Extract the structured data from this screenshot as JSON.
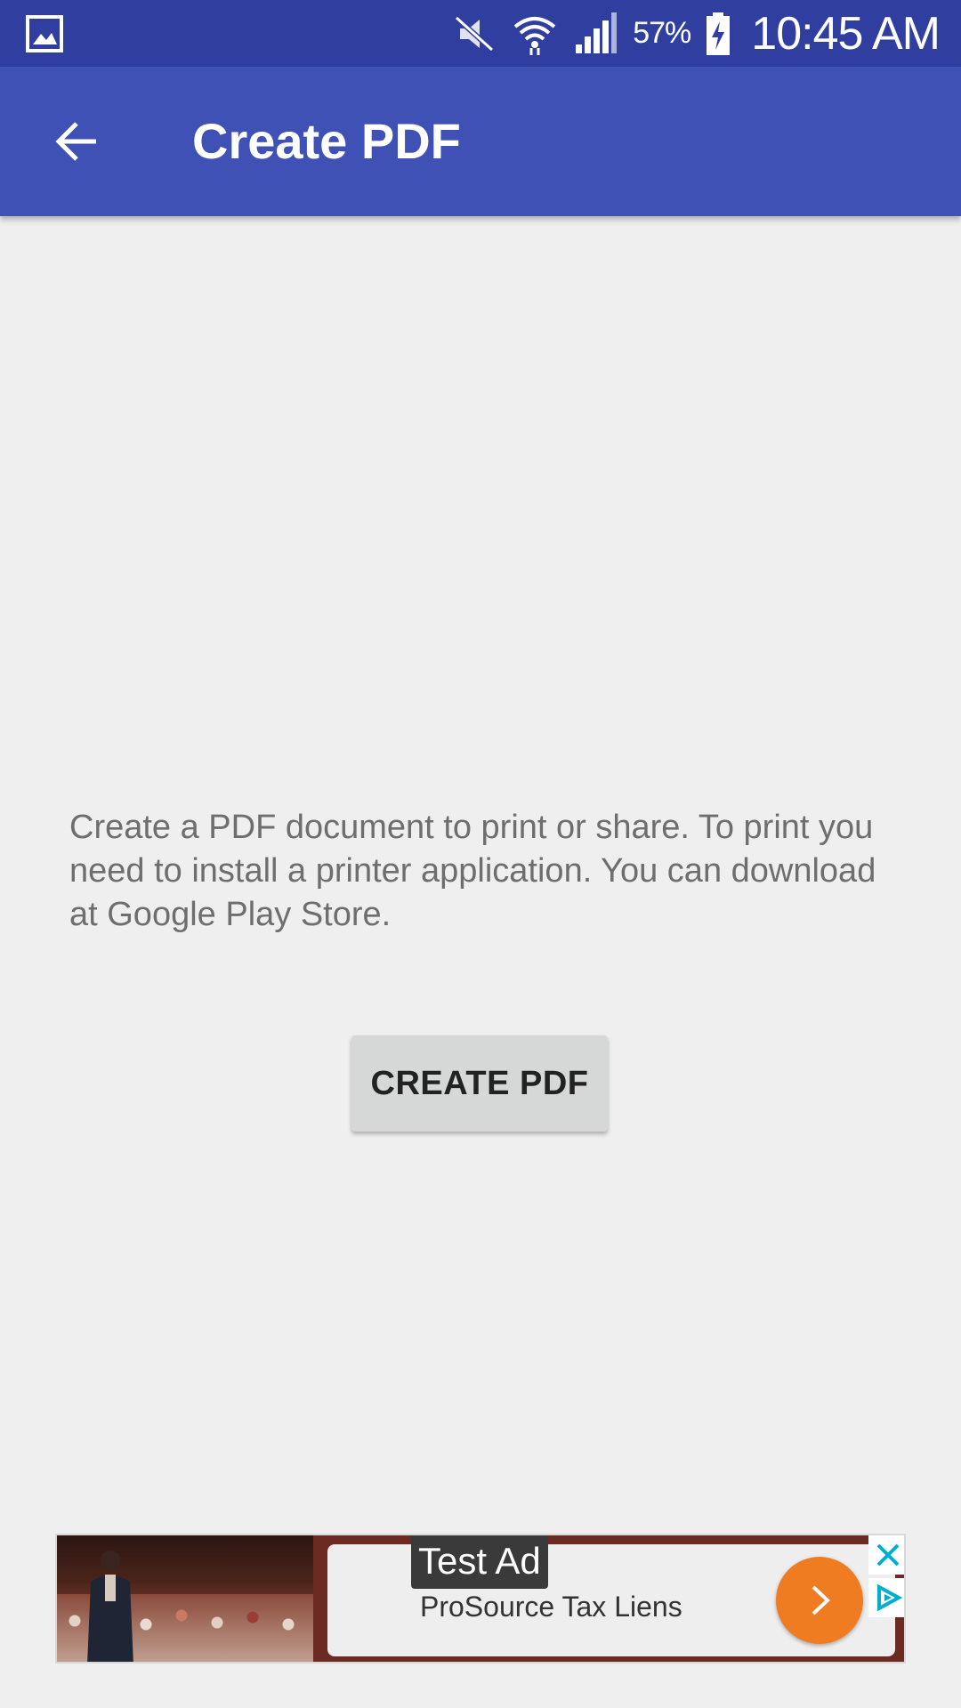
{
  "status_bar": {
    "battery_percent": "57%",
    "time": "10:45 AM",
    "icons": [
      "gallery-notification-icon",
      "mute-icon",
      "wifi-icon",
      "signal-icon",
      "battery-charging-icon"
    ]
  },
  "app_bar": {
    "title": "Create PDF",
    "back_icon": "arrow-back-icon"
  },
  "content": {
    "description": "Create a PDF document to print or share.  To print you need to install a printer application.  You can download at Google Play Store.",
    "create_button_label": "CREATE PDF"
  },
  "ad": {
    "label": "Test Ad",
    "text": "ProSource Tax Liens",
    "icons": [
      "ad-close-icon",
      "ad-choices-icon",
      "chevron-right-icon"
    ]
  },
  "colors": {
    "status_bar": "#303f9f",
    "app_bar": "#3f51b5",
    "background": "#efefef",
    "button": "#d6d7d7",
    "ad_accent": "#f07c22",
    "ad_choices": "#00aecd"
  }
}
